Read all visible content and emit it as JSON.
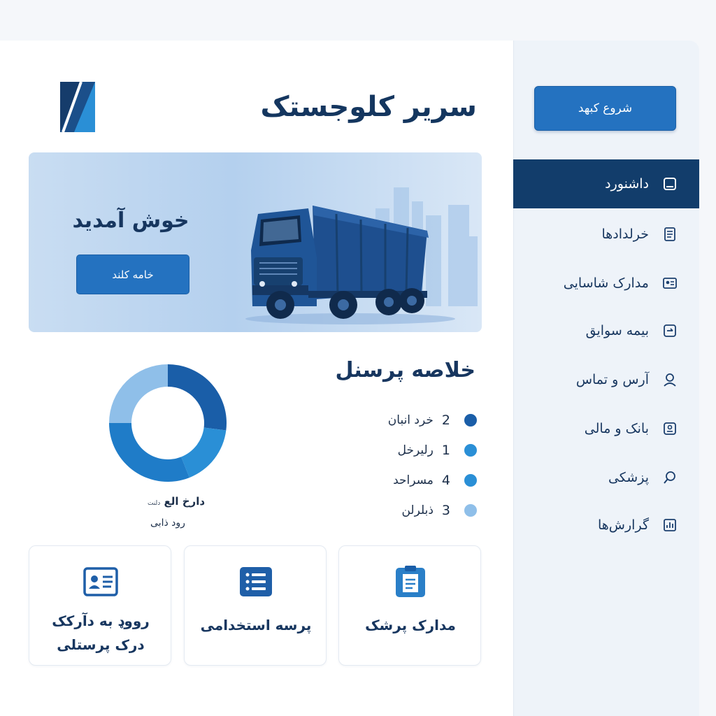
{
  "app": {
    "title": "سریر کلوجستک"
  },
  "sidebar": {
    "start_button": "شروع کبهد",
    "items": [
      {
        "label": "داشنورد",
        "icon": "dashboard-icon",
        "active": true
      },
      {
        "label": "خرلدادها",
        "icon": "contract-document-icon"
      },
      {
        "label": "مدارک شاسایی",
        "icon": "id-card-icon"
      },
      {
        "label": "بیمه سوایق",
        "icon": "insurance-card-icon"
      },
      {
        "label": "آرس و تماس",
        "icon": "contact-person-icon"
      },
      {
        "label": "بانک و مالی",
        "icon": "bank-icon"
      },
      {
        "label": "پزشکی",
        "icon": "medical-search-icon"
      },
      {
        "label": "گرارش‌ها",
        "icon": "report-chart-icon"
      }
    ]
  },
  "banner": {
    "welcome": "خوش آمدید",
    "button": "خامه کلند"
  },
  "summary": {
    "title": "خلاصه پرسنل",
    "legend": [
      {
        "count": "2",
        "label": "خرد انبان",
        "color": "#1a5ea8"
      },
      {
        "count": "1",
        "label": "رلیرخل",
        "color": "#2a8fd6"
      },
      {
        "count": "4",
        "label": "مسراحد",
        "color": "#2a8fd6"
      },
      {
        "count": "3",
        "label": "ذبلرلن",
        "color": "#8fbfe9"
      }
    ],
    "donut_caption_main": "دارخ الع",
    "donut_caption_small": "دلنت",
    "donut_caption_sub": "رود ذابی"
  },
  "chart_data": {
    "type": "pie",
    "categories": [
      "خرد انبان",
      "رلیرخل",
      "مسراحد",
      "ذبلرلن"
    ],
    "values": [
      27,
      17,
      31,
      25
    ],
    "colors": [
      "#1a5ea8",
      "#2a8fd6",
      "#1f7cc8",
      "#8fbfe9"
    ]
  },
  "cards": [
    {
      "label": "رووډ به دآرکک\nدرک پرستلی",
      "icon": "id-card-icon"
    },
    {
      "label": "پرسه استخدامی",
      "icon": "list-icon"
    },
    {
      "label": "مدارک پرشک",
      "icon": "clipboard-icon"
    }
  ]
}
